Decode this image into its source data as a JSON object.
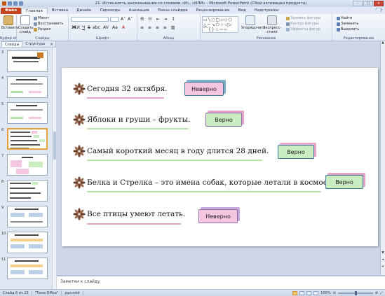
{
  "window": {
    "title": "21. Истинность высказывания со словами «И», «ИЛИ» - Microsoft PowerPoint (Сбой активации продукта)",
    "controls": [
      "–",
      "□",
      "x"
    ]
  },
  "ribbon_tabs": [
    "Файл",
    "Главная",
    "Вставка",
    "Дизайн",
    "Переходы",
    "Анимация",
    "Показ слайдов",
    "Рецензирование",
    "Вид",
    "Надстройки"
  ],
  "ribbon": {
    "clipboard": {
      "paste": "Вставить",
      "group": "Буфер обмена"
    },
    "slides": {
      "new_slide": "Создать слайд",
      "layout": "Макет",
      "reset": "Восстановить",
      "section": "Раздел",
      "group": "Слайды"
    },
    "font": {
      "group": "Шрифт",
      "bold": "Ж",
      "italic": "К",
      "underline": "Ч",
      "strike": "S",
      "shadow": "abc",
      "spacing": "AV",
      "case": "Aa",
      "color": "A"
    },
    "paragraph": {
      "group": "Абзац"
    },
    "drawing": {
      "arrange": "Упорядочить",
      "quick_styles": "Экспресс-стили",
      "fill": "Заливка фигуры",
      "outline": "Контур фигуры",
      "effects": "Эффекты фигур",
      "group": "Рисование"
    },
    "editing": {
      "find": "Найти",
      "replace": "Заменить",
      "select": "Выделить",
      "group": "Редактирование"
    }
  },
  "left_pane": {
    "tabs": [
      "Слайды",
      "Структура"
    ],
    "close": "×",
    "slide_numbers": [
      "3",
      "4",
      "5",
      "6",
      "7",
      "8",
      "9",
      "10",
      "11"
    ],
    "selected": "6"
  },
  "slide": {
    "statements": [
      {
        "text": "Сегодня 32 октября.",
        "answer": "Неверно",
        "answer_color": "#f5c6e0",
        "underline_color": "#e6a3c8"
      },
      {
        "text": "Яблоки и груши – фрукты.",
        "answer": "Верно",
        "answer_color": "#c9ecc0",
        "underline_color": "#b5e3a8"
      },
      {
        "text": "Самый короткий месяц в году длится  28 дней.",
        "answer": "Верно",
        "answer_color": "#c9ecc0",
        "underline_color": "#b5e3a8"
      },
      {
        "text": "Белка и Стрелка – это имена собак,  которые летали  в космос.",
        "answer": "Верно",
        "answer_color": "#c9ecc0",
        "underline_color": "#b5e3a8"
      },
      {
        "text": "Все птицы умеют летать.",
        "answer": "Неверно",
        "answer_color": "#f5c6e0",
        "underline_color": "#e6a3c8"
      }
    ]
  },
  "notes": {
    "placeholder": "Заметки к слайду"
  },
  "status": {
    "slide_info": "Слайд 6 из 23",
    "theme": "\"Тема Office\"",
    "language": "русский",
    "zoom": "100%"
  },
  "colors": {
    "file_tab": "#c6421c",
    "flower": "#6b3f2a",
    "selected_thumb": "#e8a23a"
  }
}
